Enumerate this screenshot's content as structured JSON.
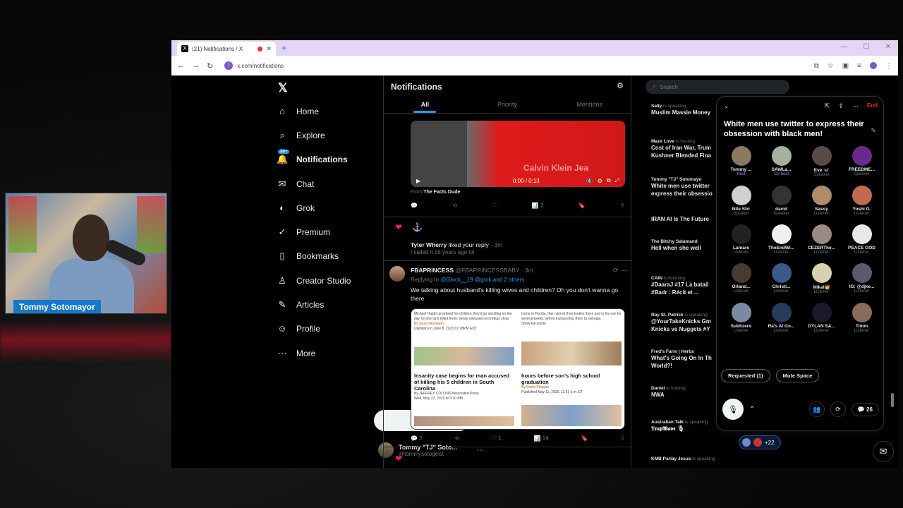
{
  "stream": {
    "name": "Tommy Sotomayor"
  },
  "browser": {
    "tab_title": "(21) Notifications / X",
    "url": "x.com/notifications"
  },
  "nav": {
    "items": [
      {
        "label": "Home",
        "icon": "⌂"
      },
      {
        "label": "Explore",
        "icon": "⌕"
      },
      {
        "label": "Notifications",
        "icon": "🔔",
        "badge": "20+"
      },
      {
        "label": "Chat",
        "icon": "✉"
      },
      {
        "label": "Grok",
        "icon": "◐"
      },
      {
        "label": "Premium",
        "icon": "✓"
      },
      {
        "label": "Bookmarks",
        "icon": "▯"
      },
      {
        "label": "Creator Studio",
        "icon": "♙"
      },
      {
        "label": "Articles",
        "icon": "✎"
      },
      {
        "label": "Profile",
        "icon": "☺"
      },
      {
        "label": "More",
        "icon": "⋯"
      }
    ],
    "post_label": "Post",
    "user": {
      "name": "Tommy \"TJ\" Soto...",
      "handle": "@tommysotogeist"
    }
  },
  "feed": {
    "title": "Notifications",
    "tabs": [
      "All",
      "Priority",
      "Mentions"
    ],
    "video": {
      "time": "0:00 / 0:13",
      "watermark": "Calvin Klein Jea"
    },
    "from_label": "From",
    "from_name": "The Facts Dude",
    "post1_counts": {
      "views": "2"
    },
    "liked": {
      "user": "Tyler Wherry",
      "text": "liked your reply",
      "time": "· 3m",
      "quote": "I called it 16 years ago lol"
    },
    "reply": {
      "name": "FBAPRINCESS",
      "handle": "@FBAPRINCESSBABY · 3m",
      "replying_to": "Replying to",
      "mentions": "@Glock__19 @grok and 2 others",
      "text": "We talking about husband's killing wives and children? Oh you don't wanna go there",
      "counts": {
        "replies": "2",
        "likes": "1",
        "views": "19"
      }
    },
    "collage": {
      "c1_small": "Michael Haight promised his children they'd go sledding on the day he shot and killed them, newly released recordings show",
      "c1_by": "By Sean Neumann",
      "c1_date": "Updated on June 8, 2023 07:28PM EDT",
      "c2_small": "home in Florida, then stored their bodies there and in his van for several weeks before transporting them to Georgia.",
      "c2_link": "Show full article",
      "c3_head": "Insanity case begins for man accused of killing his 5 children in South Carolina",
      "c3_by": "By JEFFREY COLLINS Associated Press",
      "c3_date": "Wed, May 22, 2019 at 3:10 PM",
      "c4_head": "hours before son's high school graduation",
      "c4_by": "By David Propper",
      "c4_date": "Published May 11, 2025, 11:51 p.m. ET"
    }
  },
  "right": {
    "search_placeholder": "Search",
    "trends": [
      {
        "meta": "Sally",
        "meta2": "is speaking",
        "title": "Muslim Massie Money"
      },
      {
        "meta": "Maze Love",
        "meta2": "is hosting",
        "title": "Cost of Iran War, Trum",
        "title2": "Kushner Blended Fina"
      },
      {
        "meta": "Tommy \"TJ\" Sotomayo",
        "meta2": "",
        "title": "White men use twitter",
        "title2": "express their obsessio"
      },
      {
        "meta": "",
        "meta2": "",
        "title": "IRAN AI Is The Future"
      },
      {
        "meta": "The Bitchy Salamand",
        "meta2": "",
        "title": "Hell when she well"
      },
      {
        "meta": "CAIN",
        "meta2": "is listening",
        "title": "#DaaraJ #17 La batail",
        "title2": "#Badr : Récit et ..."
      },
      {
        "meta": "Ray St. Patrick",
        "meta2": "is speaking",
        "title": "@YourTakeKnicks Gm",
        "title2": "Knicks vs Nuggets #Y"
      },
      {
        "meta": "Fred's Farm | Herbs",
        "meta2": "",
        "title": "What's Going On In Th",
        "title2": "World?!"
      },
      {
        "meta": "Daniel",
        "meta2": "is hosting",
        "title": "NWA"
      },
      {
        "meta": "Australian Talk",
        "meta2": "is speaking",
        "title": "𝕿𝖗𝖆𝖕𝖂𝖆𝖛𝖊 🎙"
      },
      {
        "meta": "KMB Parlay Jesus",
        "meta2": "is speaking",
        "title": ""
      }
    ],
    "plus_count": "+22"
  },
  "space": {
    "end_label": "End",
    "title": "White men use twitter to express their obsession with black men!",
    "participants": [
      {
        "name": "Tommy ...",
        "role": "Host",
        "color": "#8a7a60"
      },
      {
        "name": "SAWLa...",
        "role": "Co-host",
        "color": "#a6b0a0"
      },
      {
        "name": "Eve 🦋",
        "role": "Speaker",
        "color": "#5a4a45"
      },
      {
        "name": "FREEDME...",
        "role": "Speaker",
        "color": "#6a2a8a"
      },
      {
        "name": "Nite Strr",
        "role": "Speaker",
        "color": "#d0d0d0"
      },
      {
        "name": "david",
        "role": "Speaker",
        "color": "#333333"
      },
      {
        "name": "Sassy",
        "role": "Listener",
        "color": "#b08a6a"
      },
      {
        "name": "Yoshi G.",
        "role": "Listener",
        "color": "#c06a50"
      },
      {
        "name": "Lamare",
        "role": "Listener",
        "color": "#222222"
      },
      {
        "name": "TheEndWi...",
        "role": "Listener",
        "color": "#f0f0f0"
      },
      {
        "name": "CEZERThe...",
        "role": "Listener",
        "color": "#9a8a80"
      },
      {
        "name": "PEACE GOD",
        "role": "Listener",
        "color": "#e8e8e8"
      },
      {
        "name": "Orland...",
        "role": "Listener",
        "color": "#4a3a30"
      },
      {
        "name": "Christi...",
        "role": "Listener",
        "color": "#3a5a8a"
      },
      {
        "name": "Mikal👑",
        "role": "Listener",
        "color": "#d8d0b0"
      },
      {
        "name": "IG: @djke...",
        "role": "Listener",
        "color": "#5a5a6a"
      },
      {
        "name": "Subhzero",
        "role": "Listener",
        "color": "#7a8aa0"
      },
      {
        "name": "Ra's Al Go...",
        "role": "Listener",
        "color": "#2a3a5a"
      },
      {
        "name": "DYLAN SA...",
        "role": "Listener",
        "color": "#1a1a2a"
      },
      {
        "name": "Timm",
        "role": "Listener",
        "color": "#8a6a5a"
      }
    ],
    "requested_label": "Requested (1)",
    "mute_label": "Mute Space",
    "comment_count": "26"
  }
}
